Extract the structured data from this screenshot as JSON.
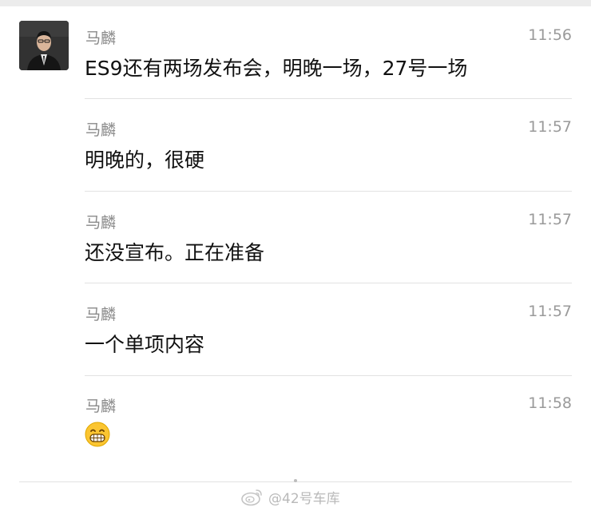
{
  "messages": [
    {
      "sender": "马麟",
      "time": "11:56",
      "text": "ES9还有两场发布会，明晚一场，27号一场"
    },
    {
      "sender": "马麟",
      "time": "11:57",
      "text": "明晚的，很硬"
    },
    {
      "sender": "马麟",
      "time": "11:57",
      "text": "还没宣布。正在准备"
    },
    {
      "sender": "马麟",
      "time": "11:57",
      "text": "一个单项内容"
    },
    {
      "sender": "马麟",
      "time": "11:58",
      "emoji": "grinning-face-with-teeth"
    }
  ],
  "watermark": {
    "text": "@42号车库",
    "icon": "weibo-icon"
  }
}
